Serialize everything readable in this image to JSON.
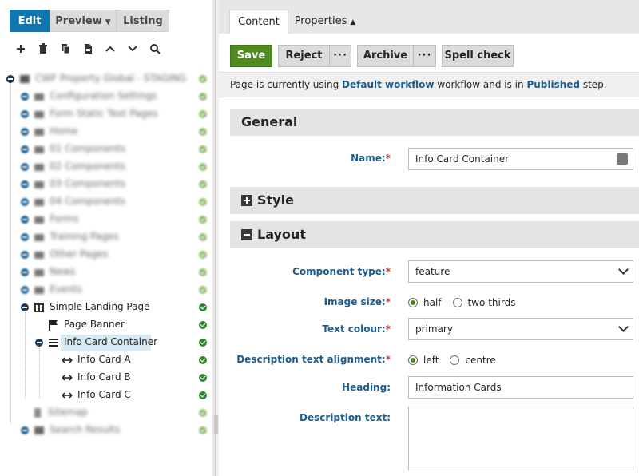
{
  "modes": {
    "edit": "Edit",
    "preview": "Preview",
    "listing": "Listing"
  },
  "toolbar_icons": [
    "plus-icon",
    "trash-icon",
    "copy-icon",
    "document-icon",
    "chevron-up-icon",
    "chevron-down-icon",
    "search-icon"
  ],
  "tree": {
    "root": "CWF Property Global - STAGING",
    "items": [
      {
        "label": "Configuration Settings"
      },
      {
        "label": "Form Static Text Pages"
      },
      {
        "label": "Home"
      },
      {
        "label": "01 Components"
      },
      {
        "label": "02 Components"
      },
      {
        "label": "03 Components"
      },
      {
        "label": "04 Components"
      },
      {
        "label": "Forms"
      },
      {
        "label": "Training Pages"
      },
      {
        "label": "Other Pages"
      },
      {
        "label": "News"
      },
      {
        "label": "Events"
      }
    ],
    "landing": "Simple Landing Page",
    "banner": "Page Banner",
    "container": "Info Card Container",
    "card_a": "Info Card A",
    "card_b": "Info Card B",
    "card_c": "Info Card C",
    "sitemap": "Sitemap",
    "search_results": "Search Results"
  },
  "tabs": {
    "content": "Content",
    "properties": "Properties"
  },
  "actions": {
    "save": "Save",
    "reject": "Reject",
    "more": "···",
    "archive": "Archive",
    "spell_check": "Spell check"
  },
  "workflow": {
    "prefix": "Page is currently using ",
    "workflow_name": "Default workflow",
    "middle": " workflow and is in ",
    "step": "Published",
    "suffix": " step."
  },
  "sections": {
    "general": "General",
    "style": "Style",
    "layout": "Layout"
  },
  "form": {
    "name_label": "Name:",
    "name_value": "Info Card Container",
    "component_type_label": "Component type:",
    "component_type_value": "feature",
    "image_size_label": "Image size:",
    "image_size_half": "half",
    "image_size_two_thirds": "two thirds",
    "text_colour_label": "Text colour:",
    "text_colour_value": "primary",
    "desc_align_label": "Description text alignment:",
    "align_left": "left",
    "align_centre": "centre",
    "heading_label": "Heading:",
    "heading_value": "Information Cards",
    "desc_text_label": "Description text:",
    "required_mark": "*"
  },
  "colors": {
    "accent": "#1175ae",
    "save": "#4f8a1f",
    "label": "#1d5d8c",
    "required": "#c0392b",
    "status_ok": "#2d8a2d"
  }
}
